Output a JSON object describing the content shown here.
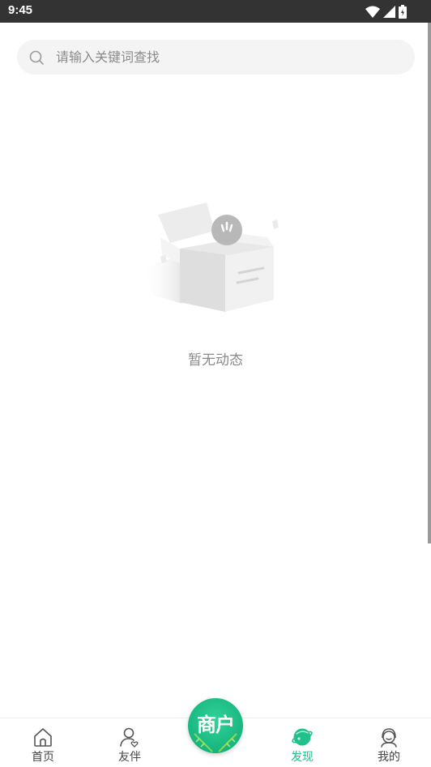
{
  "status_bar": {
    "time": "9:45"
  },
  "search": {
    "placeholder": "请输入关键词查找",
    "value": ""
  },
  "empty_state": {
    "text": "暂无动态"
  },
  "bottom_nav": {
    "items": [
      {
        "label": "首页",
        "icon": "home-icon",
        "active": false
      },
      {
        "label": "友伴",
        "icon": "friend-icon",
        "active": false
      },
      {
        "label": "发现",
        "icon": "discover-planet-icon",
        "active": true
      },
      {
        "label": "我的",
        "icon": "profile-icon",
        "active": false
      }
    ],
    "center_button": {
      "label": "商户"
    }
  },
  "colors": {
    "accent": "#21c18c",
    "status_bar": "#333333",
    "search_bg": "#f4f4f4",
    "empty_text": "#8a8a8a"
  }
}
